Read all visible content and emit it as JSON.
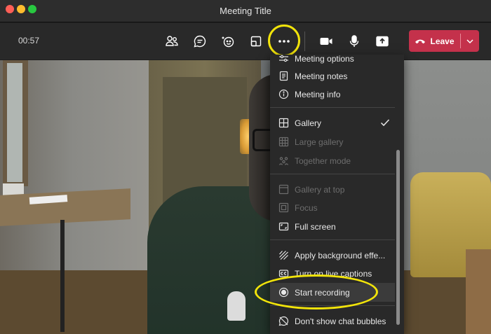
{
  "window": {
    "title": "Meeting Title"
  },
  "toolbar": {
    "timer": "00:57",
    "buttons": [
      {
        "name": "participants",
        "icon": "people-icon"
      },
      {
        "name": "chat",
        "icon": "chat-icon"
      },
      {
        "name": "reactions",
        "icon": "reactions-icon"
      },
      {
        "name": "rooms",
        "icon": "rooms-icon"
      },
      {
        "name": "more-actions",
        "icon": "more-icon"
      },
      {
        "name": "camera",
        "icon": "camera-icon"
      },
      {
        "name": "microphone",
        "icon": "microphone-icon"
      },
      {
        "name": "share",
        "icon": "share-icon"
      }
    ],
    "leave_label": "Leave"
  },
  "menu": {
    "items": [
      {
        "label": "Meeting options",
        "icon": "settings-icon",
        "state": "enabled"
      },
      {
        "label": "Meeting notes",
        "icon": "notes-icon",
        "state": "enabled"
      },
      {
        "label": "Meeting info",
        "icon": "info-icon",
        "state": "enabled"
      },
      {
        "label": "Gallery",
        "icon": "gallery-icon",
        "state": "checked"
      },
      {
        "label": "Large gallery",
        "icon": "large-gallery-icon",
        "state": "disabled"
      },
      {
        "label": "Together mode",
        "icon": "together-mode-icon",
        "state": "disabled"
      },
      {
        "label": "Gallery at top",
        "icon": "gallery-top-icon",
        "state": "disabled"
      },
      {
        "label": "Focus",
        "icon": "focus-icon",
        "state": "disabled"
      },
      {
        "label": "Full screen",
        "icon": "fullscreen-icon",
        "state": "enabled"
      },
      {
        "label": "Apply background effe...",
        "icon": "background-effects-icon",
        "state": "enabled"
      },
      {
        "label": "Turn on live captions",
        "icon": "captions-icon",
        "state": "enabled"
      },
      {
        "label": "Start recording",
        "icon": "record-icon",
        "state": "highlighted"
      },
      {
        "label": "Don't show chat bubbles",
        "icon": "chat-bubbles-off-icon",
        "state": "enabled"
      }
    ]
  },
  "colors": {
    "leave": "#c4314b",
    "highlight_annotation": "#f2e40a",
    "menu_bg": "#292929",
    "toolbar_bg": "#292929"
  }
}
